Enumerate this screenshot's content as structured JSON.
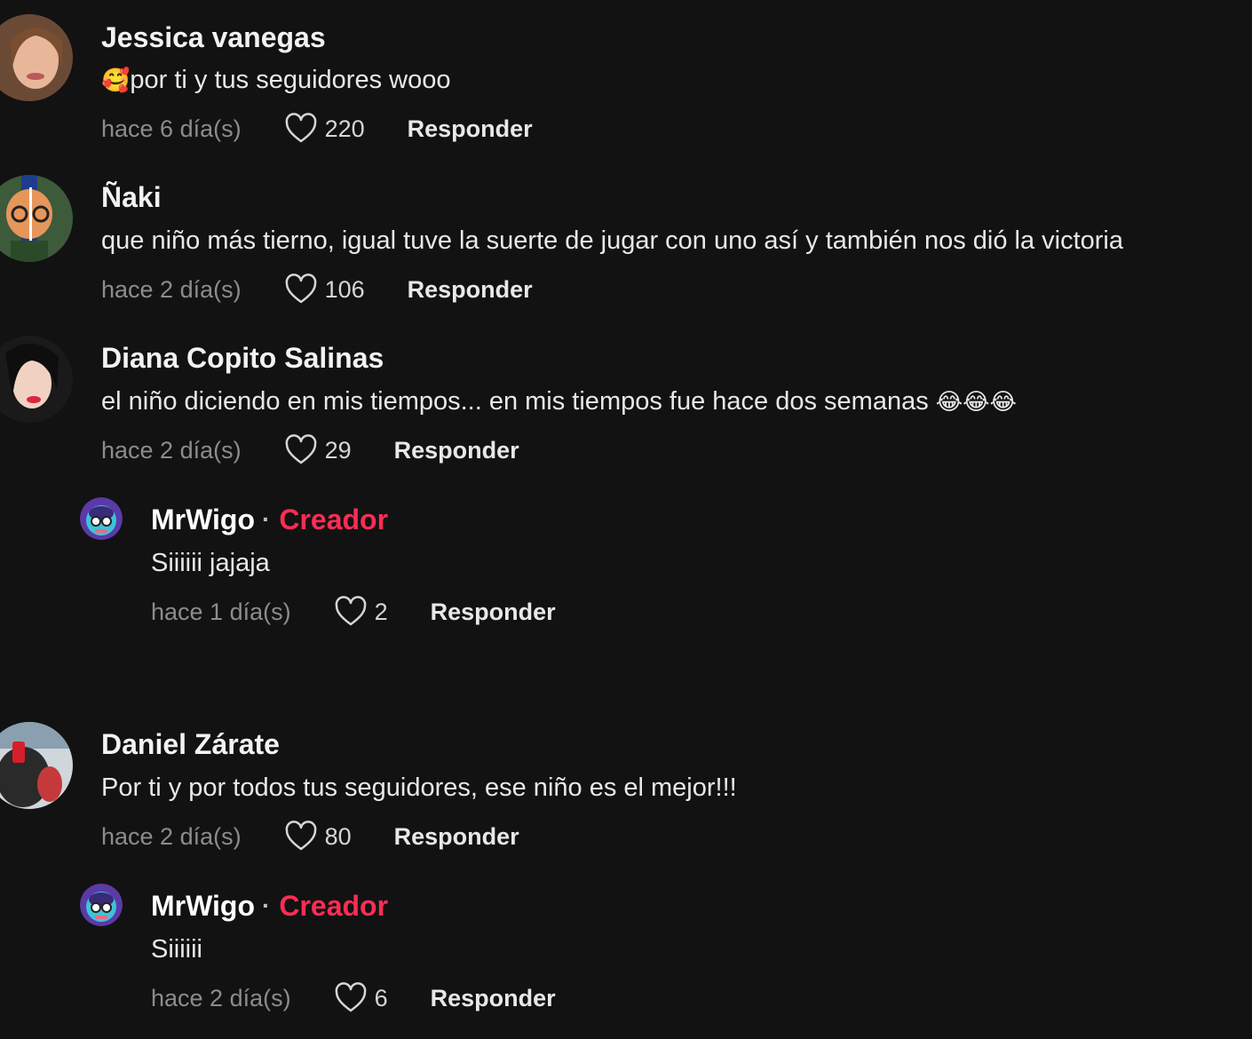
{
  "comments": [
    {
      "username": "Jessica vanegas",
      "emoji": "🥰",
      "text": "por ti y tus seguidores wooo",
      "time": "hace 6 día(s)",
      "likes": "220",
      "reply_label": "Responder"
    },
    {
      "username": "Ñaki",
      "text": "que niño más tierno, igual tuve la suerte de jugar con uno así y también nos dió la victoria",
      "time": "hace 2 día(s)",
      "likes": "106",
      "reply_label": "Responder"
    },
    {
      "username": "Diana Copito Salinas",
      "text": "el niño diciendo en mis tiempos... en mis tiempos fue hace dos semanas ",
      "emoji": "😂😂😂",
      "time": "hace 2 día(s)",
      "likes": "29",
      "reply_label": "Responder",
      "reply": {
        "username": "MrWigo",
        "separator": "·",
        "badge": "Creador",
        "text": "Siiiiii jajaja",
        "time": "hace 1 día(s)",
        "likes": "2",
        "reply_label": "Responder"
      }
    },
    {
      "username": "Daniel Zárate",
      "text": "Por ti y por todos tus seguidores, ese niño es el mejor!!!",
      "time": "hace 2 día(s)",
      "likes": "80",
      "reply_label": "Responder",
      "reply": {
        "username": "MrWigo",
        "separator": "·",
        "badge": "Creador",
        "text": "Siiiiii",
        "time": "hace 2 día(s)",
        "likes": "6",
        "reply_label": "Responder"
      }
    }
  ],
  "colors": {
    "background": "#121212",
    "creator_badge": "#fe2c55",
    "muted_text": "#8c8c8c"
  },
  "icons": {
    "like": "heart-outline-icon"
  }
}
